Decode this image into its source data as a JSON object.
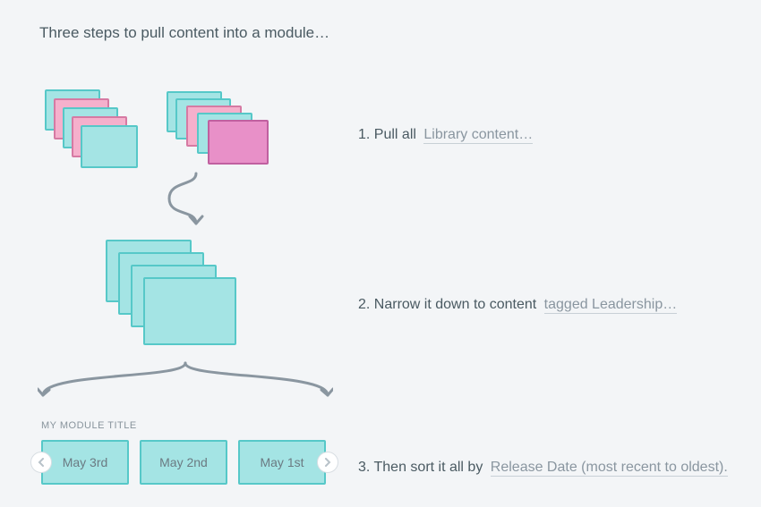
{
  "title": "Three steps to pull content into a module…",
  "steps": {
    "s1_prefix": "1. Pull all",
    "s1_link": "Library content…",
    "s2_prefix": "2. Narrow it down to content",
    "s2_link": "tagged Leadership…",
    "s3_prefix": "3. Then sort it all by",
    "s3_link": "Release Date (most recent to oldest)."
  },
  "module": {
    "label": "MY MODULE TITLE",
    "cards": [
      "May 3rd",
      "May 2nd",
      "May 1st"
    ]
  },
  "icons": {
    "prev": "‹",
    "next": "›"
  }
}
